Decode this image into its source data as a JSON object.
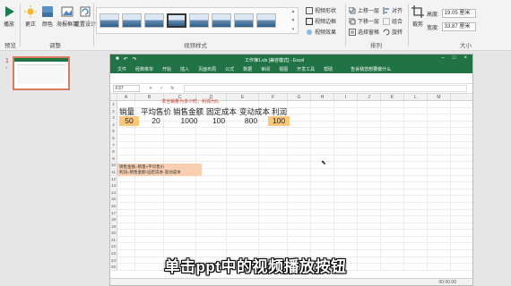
{
  "ribbon": {
    "buttons": {
      "play": "播放",
      "correct": "更正",
      "color": "颜色",
      "poster_frame": "海报框架",
      "reset": "重置设计"
    },
    "groups": {
      "preview": "预览",
      "adjust": "调整",
      "video_styles": "视频样式",
      "arrange": "排列",
      "size": "大小"
    },
    "video_style_options": {
      "shape": "视频形状",
      "border": "视频边框",
      "effects": "视频效果"
    },
    "arrange_options": {
      "bring_forward": "上移一层",
      "send_backward": "下移一层",
      "selection_pane": "选择窗格",
      "align": "对齐",
      "group": "组合",
      "rotate": "旋转"
    },
    "crop": "裁剪",
    "size": {
      "height_label": "高度:",
      "height_value": "19.05 厘米",
      "width_label": "宽度:",
      "width_value": "33.87 厘米"
    }
  },
  "slide_panel": {
    "slide_number": "1",
    "star": "*"
  },
  "excel": {
    "title": "工作簿1.xls [兼容模式] - Excel",
    "menu": [
      "文件",
      "经典菜单",
      "开始",
      "插入",
      "页面布局",
      "公式",
      "数据",
      "审阅",
      "视图",
      "开发工具",
      "帮助"
    ],
    "tell_me": "告诉我您想要做什么",
    "name_box": "F37",
    "columns": [
      "A",
      "B",
      "C",
      "D",
      "E",
      "F",
      "G",
      "H",
      "I",
      "J",
      "K",
      "L",
      "M"
    ],
    "rows": [
      "1",
      "2",
      "3",
      "4",
      "5",
      "6",
      "7",
      "8",
      "9",
      "10",
      "11",
      "12",
      "13",
      "14",
      "15",
      "16",
      "17",
      "18",
      "19",
      "20",
      "21",
      "22",
      "23",
      "24",
      "25"
    ],
    "red_hint": "求当销量为多少时，利润为0。",
    "headers": [
      "销量",
      "平均售价",
      "销售金额",
      "固定成本",
      "变动成本",
      "利润"
    ],
    "values": [
      "50",
      "20",
      "1000",
      "100",
      "800",
      "100"
    ],
    "formula_lines": [
      "销售金额=销量×平均售价",
      "利润=销售金额-固定成本-变动成本"
    ],
    "video_time": "00:00.00"
  },
  "subtitle": "单击ppt中的视频播放按钮"
}
